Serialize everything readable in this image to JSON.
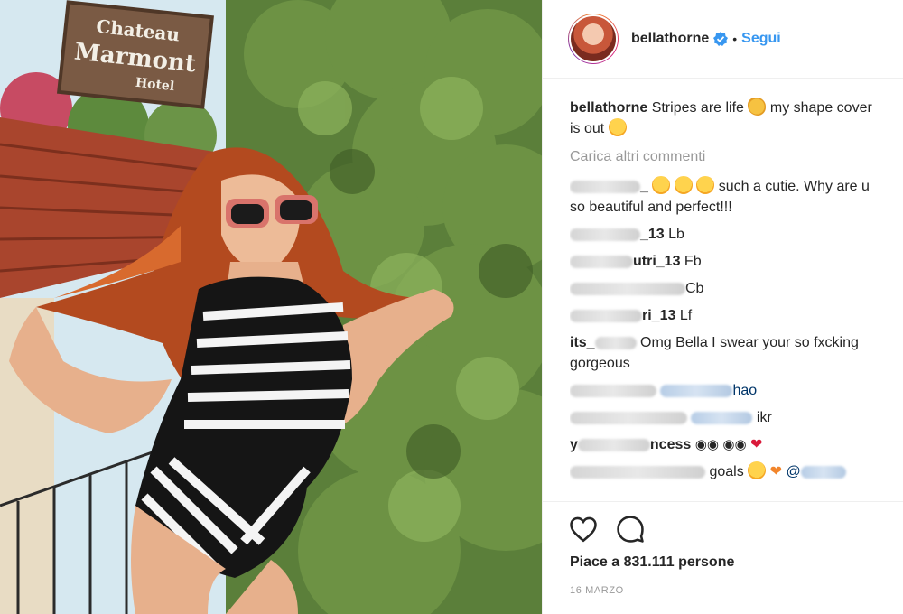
{
  "post": {
    "username": "bellathorne",
    "separator": "•",
    "follow_label": "Segui",
    "sign": {
      "line1": "Chateau",
      "line2": "Marmont",
      "line3": "Hotel"
    }
  },
  "caption": {
    "username": "bellathorne",
    "text_1": "Stripes are life",
    "text_2": "my shape cover is out",
    "emoji_1": "waving-hand",
    "emoji_2": "heart-eyes"
  },
  "load_more": "Carica altri commenti",
  "comments": [
    {
      "user_suffix": "_",
      "text": "such a cutie. Why are u so beautiful and perfect!!!"
    },
    {
      "user_suffix": "_13",
      "text": "Lb"
    },
    {
      "user_suffix": "utri_13",
      "text": "Fb"
    },
    {
      "user_suffix": "",
      "text": "Cb"
    },
    {
      "user_suffix": "ri_13",
      "text": "Lf"
    },
    {
      "user_prefix": "its_",
      "text": "Omg Bella I swear your so fxcking gorgeous"
    },
    {
      "text": "hao"
    },
    {
      "text": "ikr"
    },
    {
      "user_visible": "y",
      "user_suffix": "ncess"
    },
    {
      "text": "goals",
      "mention": "@"
    }
  ],
  "likes": "Piace a 831.111 persone",
  "date": "16 MARZO",
  "colors": {
    "link": "#3897f0",
    "muted": "#999999",
    "text": "#262626"
  }
}
